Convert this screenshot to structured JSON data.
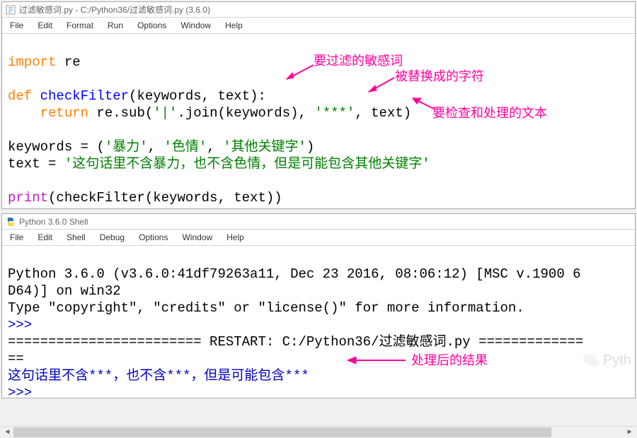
{
  "editor": {
    "title": "过滤敏感词.py - C:/Python36/过滤敏感词.py (3.6.0)",
    "menu": [
      "File",
      "Edit",
      "Format",
      "Run",
      "Options",
      "Window",
      "Help"
    ],
    "code": {
      "l1_import": "import",
      "l1_re": " re",
      "l2_def": "def",
      "l2_fn": " checkFilter",
      "l2_sig": "(keywords, text):",
      "l3_ret": "    return",
      "l3_call": " re.sub(",
      "l3_s1": "'|'",
      "l3_join": ".join(keywords), ",
      "l3_s2": "'***'",
      "l3_tail": ", text)",
      "l4_kw": "keywords = (",
      "l4_s1": "'暴力'",
      "l4_c1": ", ",
      "l4_s2": "'色情'",
      "l4_c2": ", ",
      "l4_s3": "'其他关键字'",
      "l4_end": ")",
      "l5_t": "text = ",
      "l5_s": "'这句话里不含暴力，也不含色情，但是可能包含其他关键字'",
      "l6_p": "print",
      "l6_c": "(checkFilter(keywords, text))"
    },
    "annot": {
      "a1": "要过滤的敏感词",
      "a2": "被替换成的字符",
      "a3": "要检查和处理的文本"
    }
  },
  "shell": {
    "title": "Python 3.6.0 Shell",
    "menu": [
      "File",
      "Edit",
      "Shell",
      "Debug",
      "Options",
      "Window",
      "Help"
    ],
    "banner1": "Python 3.6.0 (v3.6.0:41df79263a11, Dec 23 2016, 08:06:12) [MSC v.1900 6",
    "banner2": "D64)] on win32",
    "banner3": "Type \"copyright\", \"credits\" or \"license()\" for more information.",
    "prompt": ">>> ",
    "restart_line": "======================== RESTART: C:/Python36/过滤敏感词.py =============",
    "restart_tail": "==",
    "output": "这句话里不含***，也不含***，但是可能包含***",
    "annot_result": "处理后的结果"
  },
  "watermark": "Pyth"
}
